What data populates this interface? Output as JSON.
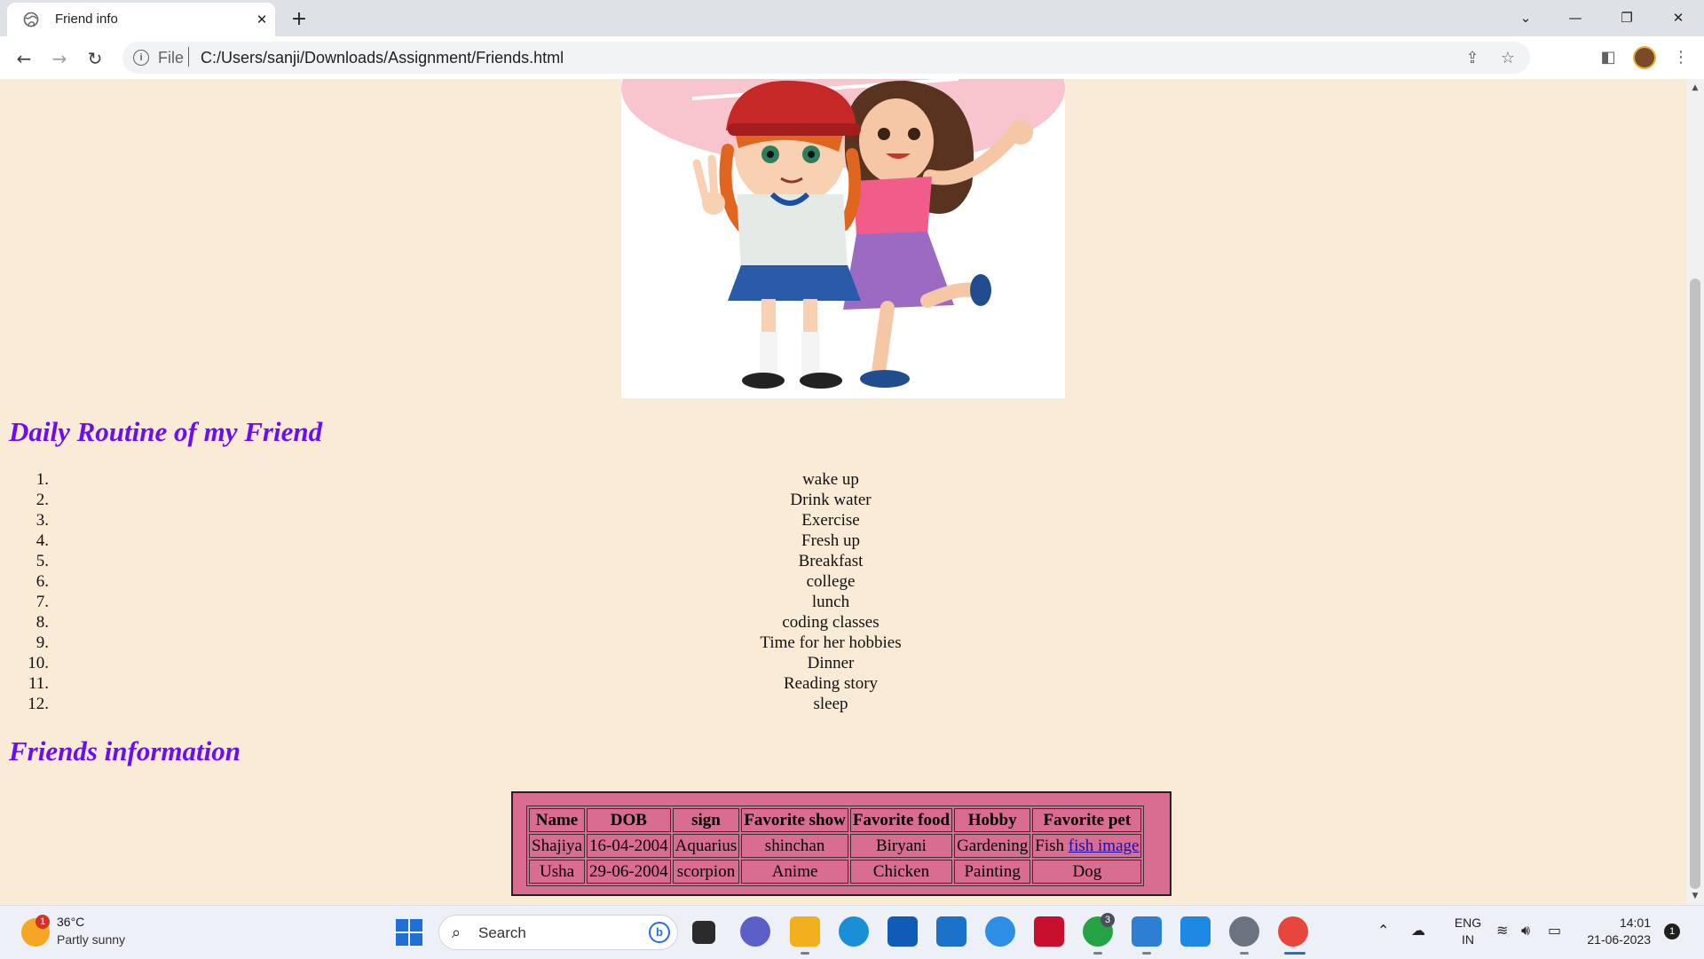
{
  "browser": {
    "tab_title": "Friend info",
    "url_scheme": "File",
    "url": "C:/Users/sanji/Downloads/Assignment/Friends.html"
  },
  "page": {
    "routine_heading": "Daily Routine of my Friend",
    "routine": [
      {
        "n": "1.",
        "text": "wake up"
      },
      {
        "n": "2.",
        "text": "Drink water"
      },
      {
        "n": "3.",
        "text": "Exercise"
      },
      {
        "n": "4.",
        "text": "Fresh up"
      },
      {
        "n": "5.",
        "text": "Breakfast"
      },
      {
        "n": "6.",
        "text": "college"
      },
      {
        "n": "7.",
        "text": "lunch"
      },
      {
        "n": "8.",
        "text": "coding classes"
      },
      {
        "n": "9.",
        "text": "Time for her hobbies"
      },
      {
        "n": "10.",
        "text": "Dinner"
      },
      {
        "n": "11.",
        "text": "Reading story"
      },
      {
        "n": "12.",
        "text": "sleep"
      }
    ],
    "info_heading": "Friends information",
    "table": {
      "headers": [
        "Name",
        "DOB",
        "sign",
        "Favorite show",
        "Favorite food",
        "Hobby",
        "Favorite pet"
      ],
      "rows": [
        [
          "Shajiya",
          "16-04-2004",
          "Aquarius",
          "shinchan",
          "Biryani",
          "Gardening",
          "Fish"
        ],
        [
          "Usha",
          "29-06-2004",
          "scorpion",
          "Anime",
          "Chicken",
          "Painting",
          "Dog"
        ]
      ],
      "link_text": "fish image"
    },
    "colors": {
      "heading": "#6a0dff",
      "background": "#faebd7",
      "table_bg": "#d96c91"
    }
  },
  "taskbar": {
    "temperature": "36°C",
    "weather": "Partly sunny",
    "weather_badge": "1",
    "search_label": "Search",
    "lang_line1": "ENG",
    "lang_line2": "IN",
    "time": "14:01",
    "date": "21-06-2023",
    "notification_count": "1",
    "whatsapp_badge": "3"
  }
}
